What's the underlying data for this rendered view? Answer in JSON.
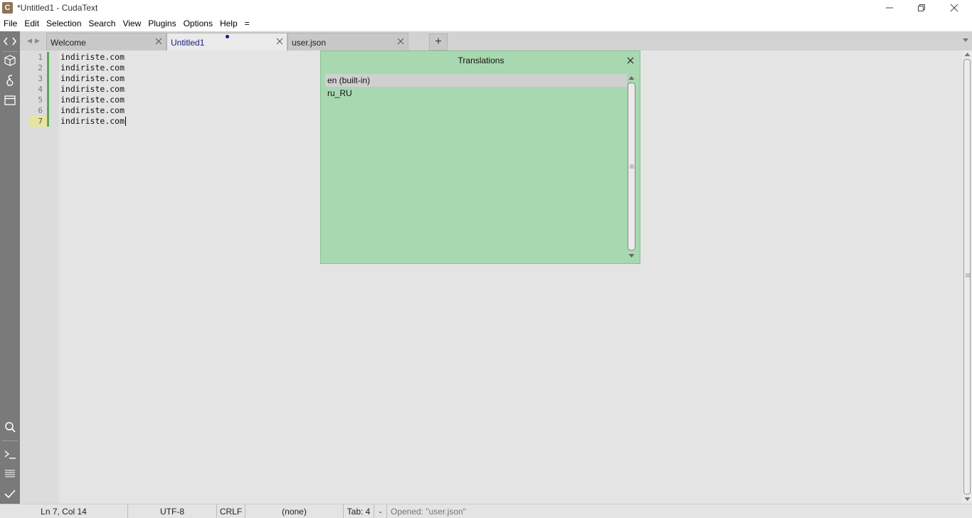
{
  "window": {
    "title": "*Untitled1 - CudaText",
    "app_icon_letter": "C"
  },
  "menu": [
    "File",
    "Edit",
    "Selection",
    "Search",
    "View",
    "Plugins",
    "Options",
    "Help",
    "="
  ],
  "sidebar": {
    "top_icons": [
      "code-tree-icon",
      "project-icon",
      "snippets-icon",
      "tabs-icon"
    ],
    "bottom_icons": [
      "search-icon",
      "console-icon",
      "output-icon",
      "validate-icon"
    ]
  },
  "tabs": [
    {
      "label": "Welcome",
      "active": false,
      "modified": false
    },
    {
      "label": "Untitled1",
      "active": true,
      "modified": true
    },
    {
      "label": "user.json",
      "active": false,
      "modified": false
    }
  ],
  "new_tab_label": "+",
  "editor": {
    "lines": [
      {
        "num": "1",
        "text": "indiriste.com"
      },
      {
        "num": "2",
        "text": "indiriste.com"
      },
      {
        "num": "3",
        "text": "indiriste.com"
      },
      {
        "num": "4",
        "text": "indiriste.com"
      },
      {
        "num": "5",
        "text": "indiriste.com"
      },
      {
        "num": "6",
        "text": "indiriste.com"
      },
      {
        "num": "7",
        "text": "indiriste.com"
      }
    ],
    "current_line": 7
  },
  "translations_dialog": {
    "title": "Translations",
    "items": [
      {
        "label": "en (built-in)",
        "selected": true
      },
      {
        "label": "ru_RU",
        "selected": false
      }
    ]
  },
  "status": {
    "position": "Ln 7, Col 14",
    "encoding": "UTF-8",
    "line_ending": "CRLF",
    "lexer": "(none)",
    "tab_size": "Tab: 4",
    "separator": "-",
    "message": "Opened: \"user.json\""
  },
  "colors": {
    "dialog_bg": "#a8d8b0",
    "sidebar_bg": "#7a7a7a",
    "editor_bg": "#e4e4e4",
    "modified_bar": "#58a858"
  }
}
